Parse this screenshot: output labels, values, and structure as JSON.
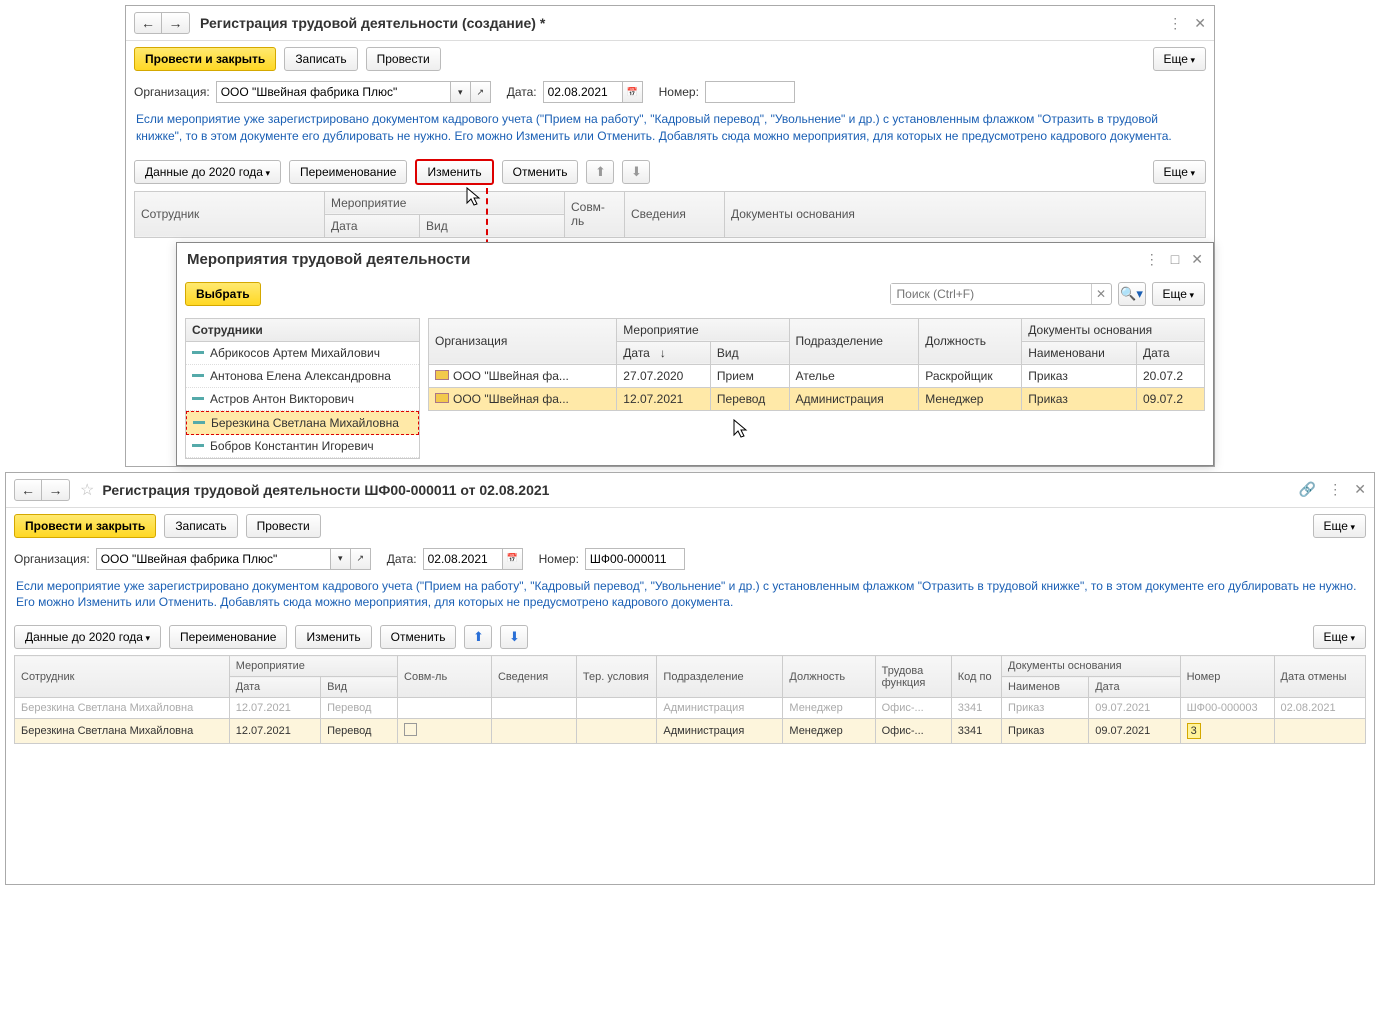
{
  "win1": {
    "title": "Регистрация трудовой деятельности (создание) *",
    "buttons": {
      "post_close": "Провести и закрыть",
      "save": "Записать",
      "post": "Провести",
      "more": "Еще"
    },
    "fields": {
      "org_label": "Организация:",
      "org_value": "ООО \"Швейная фабрика Плюс\"",
      "date_label": "Дата:",
      "date_value": "02.08.2021",
      "num_label": "Номер:",
      "num_value": ""
    },
    "info": "Если мероприятие уже зарегистрировано документом кадрового учета (\"Прием на работу\", \"Кадровый перевод\", \"Увольнение\" и др.) с установленным флажком \"Отразить в трудовой книжке\", то в этом документе его дублировать не нужно. Его можно Изменить или Отменить. Добавлять сюда можно мероприятия, для которых не предусмотрено кадрового документа.",
    "toolbar": {
      "before2020": "Данные до 2020 года",
      "rename": "Переименование",
      "change": "Изменить",
      "cancel": "Отменить"
    },
    "table_headers": {
      "employee": "Сотрудник",
      "event": "Мероприятие",
      "date": "Дата",
      "type": "Вид",
      "combine": "Совм-ль",
      "info": "Сведения",
      "docs": "Документы основания"
    }
  },
  "popup": {
    "title": "Мероприятия трудовой деятельности",
    "select_btn": "Выбрать",
    "search_ph": "Поиск (Ctrl+F)",
    "more": "Еще",
    "emp_header": "Сотрудники",
    "employees": [
      "Абрикосов Артем Михайлович",
      "Антонова Елена Александровна",
      "Астров Антон Викторович",
      "Березкина Светлана Михайловна",
      "Бобров Константин Игоревич"
    ],
    "event_headers": {
      "org": "Организация",
      "event": "Мероприятие",
      "date": "Дата",
      "type": "Вид",
      "dept": "Подразделение",
      "pos": "Должность",
      "docs": "Документы основания",
      "doc_name": "Наименовани",
      "doc_date": "Дата"
    },
    "event_rows": [
      {
        "org": "ООО \"Швейная фа...",
        "date": "27.07.2020",
        "type": "Прием",
        "dept": "Ателье",
        "pos": "Раскройщик",
        "doc": "Приказ",
        "ddate": "20.07.2"
      },
      {
        "org": "ООО \"Швейная фа...",
        "date": "12.07.2021",
        "type": "Перевод",
        "dept": "Администрация",
        "pos": "Менеджер",
        "doc": "Приказ",
        "ddate": "09.07.2"
      }
    ]
  },
  "win2": {
    "title": "Регистрация трудовой деятельности ШФ00-000011 от 02.08.2021",
    "buttons": {
      "post_close": "Провести и закрыть",
      "save": "Записать",
      "post": "Провести",
      "more": "Еще"
    },
    "fields": {
      "org_label": "Организация:",
      "org_value": "ООО \"Швейная фабрика Плюс\"",
      "date_label": "Дата:",
      "date_value": "02.08.2021",
      "num_label": "Номер:",
      "num_value": "ШФ00-000011"
    },
    "info": "Если мероприятие уже зарегистрировано документом кадрового учета (\"Прием на работу\", \"Кадровый перевод\", \"Увольнение\" и др.) с установленным флажком \"Отразить в трудовой книжке\", то в этом документе его дублировать не нужно. Его можно Изменить или Отменить. Добавлять сюда можно мероприятия, для которых не предусмотрено кадрового документа.",
    "toolbar": {
      "before2020": "Данные до 2020 года",
      "rename": "Переименование",
      "change": "Изменить",
      "cancel": "Отменить"
    },
    "headers": {
      "employee": "Сотрудник",
      "event": "Мероприятие",
      "date": "Дата",
      "type": "Вид",
      "combine": "Совм-ль",
      "info": "Сведения",
      "ter": "Тер. условия",
      "dept": "Подразделение",
      "pos": "Должность",
      "labor": "Трудова функция",
      "code": "Код по",
      "docs": "Документы основания",
      "doc_name": "Наименов",
      "doc_date": "Дата",
      "number": "Номер",
      "cancel_date": "Дата отмены"
    },
    "rows": [
      {
        "emp": "Березкина Светлана Михайловна",
        "date": "12.07.2021",
        "type": "Перевод",
        "dept": "Администрация",
        "pos": "Менеджер",
        "labor": "Офис-...",
        "code": "3341",
        "doc": "Приказ",
        "ddate": "09.07.2021",
        "num": "ШФ00-000003",
        "cdate": "02.08.2021"
      },
      {
        "emp": "Березкина Светлана Михайловна",
        "date": "12.07.2021",
        "type": "Перевод",
        "dept": "Администрация",
        "pos": "Менеджер",
        "labor": "Офис-...",
        "code": "3341",
        "doc": "Приказ",
        "ddate": "09.07.2021",
        "num": "3",
        "cdate": ""
      }
    ]
  }
}
